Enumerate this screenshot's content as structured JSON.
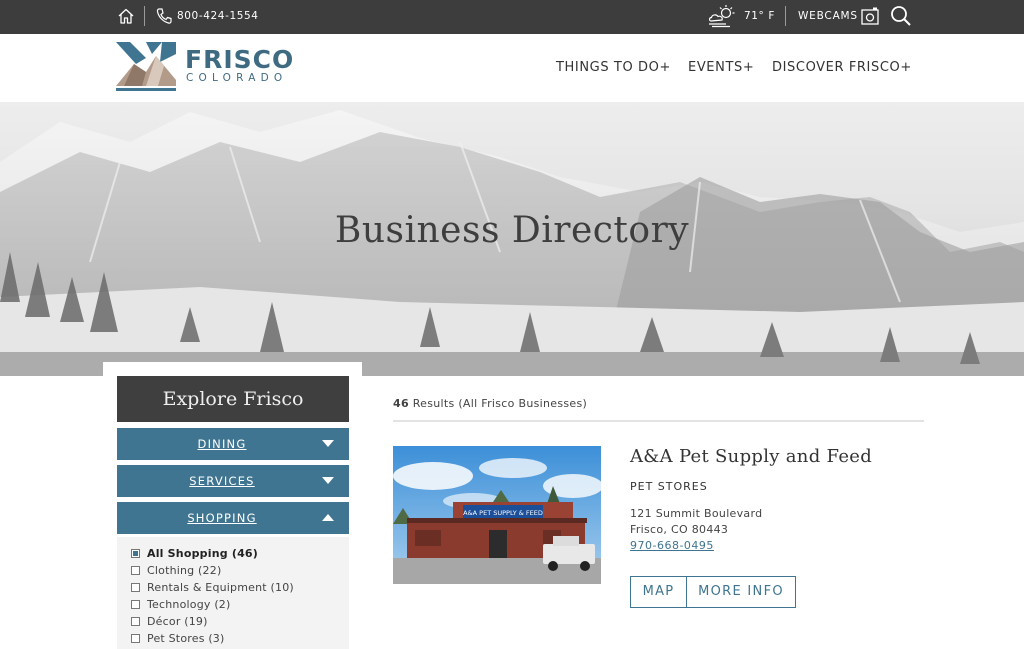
{
  "topbar": {
    "phone": "800-424-1554",
    "temperature": "71° F",
    "webcams_label": "WEBCAMS",
    "icons": [
      "home-icon",
      "phone-icon",
      "weather-icon",
      "camera-icon",
      "search-icon"
    ]
  },
  "logo": {
    "word": "FRISCO",
    "sub": "COLORADO"
  },
  "nav": {
    "items": [
      "THINGS TO DO+",
      "EVENTS+",
      "DISCOVER FRISCO+"
    ]
  },
  "hero": {
    "title": "Business Directory"
  },
  "sidebar": {
    "heading": "Explore Frisco",
    "categories": [
      {
        "label": "DINING",
        "expanded": false
      },
      {
        "label": "SERVICES",
        "expanded": false
      },
      {
        "label": "SHOPPING",
        "expanded": true
      }
    ],
    "subcategories": [
      {
        "label": "All Shopping (46)",
        "checked": true
      },
      {
        "label": "Clothing (22)",
        "checked": false
      },
      {
        "label": "Rentals & Equipment (10)",
        "checked": false
      },
      {
        "label": "Technology (2)",
        "checked": false
      },
      {
        "label": "Décor (19)",
        "checked": false
      },
      {
        "label": "Pet Stores (3)",
        "checked": false
      }
    ]
  },
  "results": {
    "count": "46",
    "count_suffix": "Results (All Frisco Businesses)"
  },
  "listing": {
    "name": "A&A Pet Supply and Feed",
    "category": "PET STORES",
    "address_line1": "121 Summit Boulevard",
    "address_line2": "Frisco, CO 80443",
    "phone": "970-668-0495",
    "map_button": "MAP",
    "info_button": "MORE INFO",
    "sign_text": "A&A PET SUPPLY & FEED"
  },
  "colors": {
    "brand_blue": "#3f7590",
    "topbar_bg": "#3d3d3d",
    "explore_bg": "#3f3f3f"
  }
}
